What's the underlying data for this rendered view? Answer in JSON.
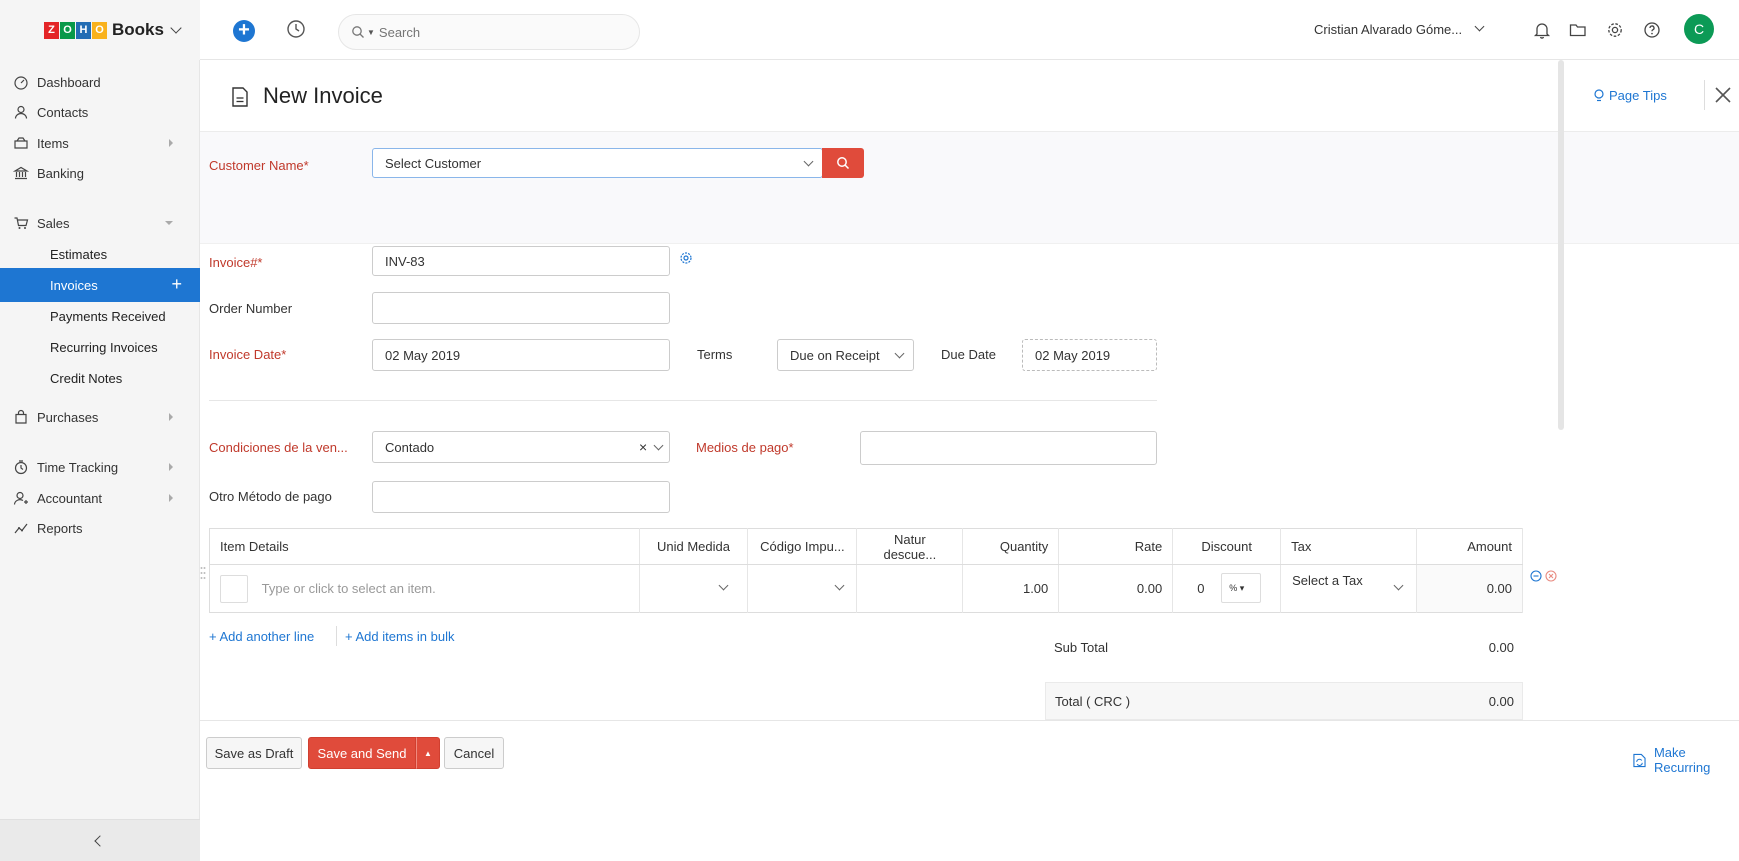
{
  "topbar": {
    "brand_letters": [
      "Z",
      "O",
      "H",
      "O"
    ],
    "brand_colors": [
      "#e42527",
      "#089949",
      "#226db4",
      "#f9b21d"
    ],
    "brand_name": "Books",
    "search_placeholder": "Search",
    "user_name": "Cristian Alvarado Góme...",
    "avatar_initial": "C",
    "accent_color": "#1e76d2",
    "avatar_color": "#0c9a56"
  },
  "sidebar": {
    "items": [
      {
        "label": "Dashboard",
        "icon": "dashboard-icon"
      },
      {
        "label": "Contacts",
        "icon": "contacts-icon"
      },
      {
        "label": "Items",
        "icon": "items-icon"
      },
      {
        "label": "Banking",
        "icon": "banking-icon"
      },
      {
        "label": "Sales",
        "icon": "sales-icon"
      },
      {
        "label": "Purchases",
        "icon": "purchases-icon"
      },
      {
        "label": "Time Tracking",
        "icon": "time-tracking-icon"
      },
      {
        "label": "Accountant",
        "icon": "accountant-icon"
      },
      {
        "label": "Reports",
        "icon": "reports-icon"
      }
    ],
    "sales_sub": [
      {
        "label": "Estimates",
        "active": false
      },
      {
        "label": "Invoices",
        "active": true
      },
      {
        "label": "Payments Received",
        "active": false
      },
      {
        "label": "Recurring Invoices",
        "active": false
      },
      {
        "label": "Credit Notes",
        "active": false
      }
    ]
  },
  "header": {
    "title": "New Invoice",
    "page_tips": "Page Tips"
  },
  "form": {
    "customer_label": "Customer Name*",
    "customer_placeholder": "Select Customer",
    "invoice_label": "Invoice#*",
    "invoice_value": "INV-83",
    "order_label": "Order Number",
    "order_value": "",
    "invoice_date_label": "Invoice Date*",
    "invoice_date_value": "02 May 2019",
    "terms_label": "Terms",
    "terms_value": "Due on Receipt",
    "due_date_label": "Due Date",
    "due_date_value": "02 May 2019",
    "condiciones_label": "Condiciones de la ven...",
    "condiciones_value": "Contado",
    "medios_label": "Medios de pago*",
    "medios_value": "",
    "otro_label": "Otro Método de pago",
    "otro_value": ""
  },
  "table": {
    "headers": [
      "Item Details",
      "Unid Medida",
      "Código Impu...",
      "Natur descue...",
      "Quantity",
      "Rate",
      "Discount",
      "Tax",
      "Amount"
    ],
    "row": {
      "item_placeholder": "Type or click to select an item.",
      "quantity": "1.00",
      "rate": "0.00",
      "discount": "0",
      "discount_unit": "%",
      "tax_placeholder": "Select a Tax",
      "amount": "0.00"
    },
    "add_line": "+ Add another line",
    "add_bulk": "+ Add items in bulk"
  },
  "totals": {
    "subtotal_label": "Sub Total",
    "subtotal_value": "0.00",
    "total_label": "Total ( CRC )",
    "total_value": "0.00"
  },
  "footer": {
    "save_draft": "Save as Draft",
    "save_send": "Save and Send",
    "cancel": "Cancel",
    "make_recurring": "Make Recurring"
  }
}
